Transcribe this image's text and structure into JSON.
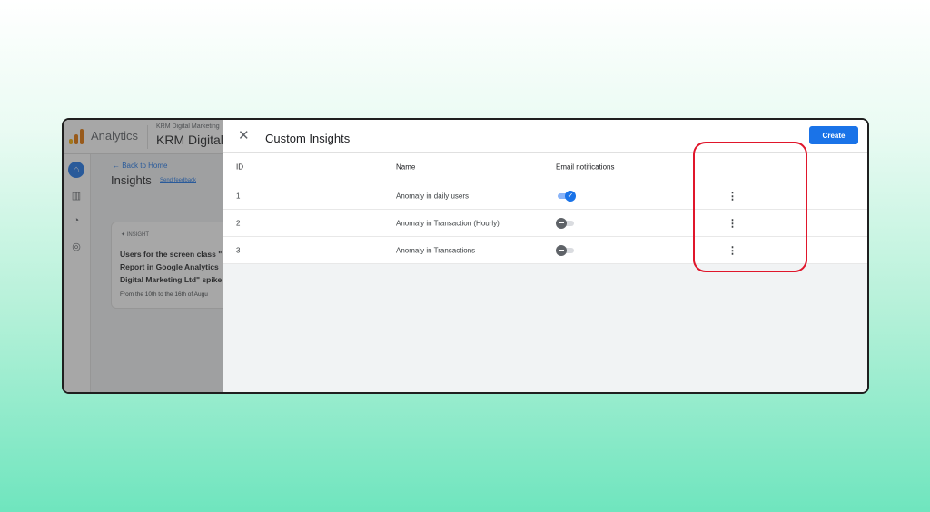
{
  "app": {
    "title": "Analytics",
    "account_small": "KRM Digital Marketing",
    "account_big": "KRM Digital U"
  },
  "background": {
    "back_link": "← Back to Home",
    "page_title": "Insights",
    "send_feedback": "Send feedback",
    "card": {
      "tag": "INSIGHT",
      "line1": "Users for the screen class \"",
      "line2": "Report in Google Analytics",
      "line3": "Digital Marketing Ltd\" spike",
      "footer": "From the 10th to the 16th of Augu"
    }
  },
  "panel": {
    "title": "Custom Insights",
    "create_label": "Create",
    "columns": {
      "id": "ID",
      "name": "Name",
      "email": "Email notifications"
    },
    "rows": [
      {
        "id": "1",
        "name": "Anomaly in daily users",
        "email_on": true
      },
      {
        "id": "2",
        "name": "Anomaly in Transaction (Hourly)",
        "email_on": false
      },
      {
        "id": "3",
        "name": "Anomaly in Transactions",
        "email_on": false
      }
    ]
  },
  "colors": {
    "accent": "#1a73e8",
    "highlight": "#e0162b"
  },
  "icons": {
    "close": "close-icon",
    "more": "more-vert-icon",
    "home": "home-icon",
    "reports": "bar-chart-icon",
    "explore": "explore-icon",
    "advertising": "target-icon"
  }
}
